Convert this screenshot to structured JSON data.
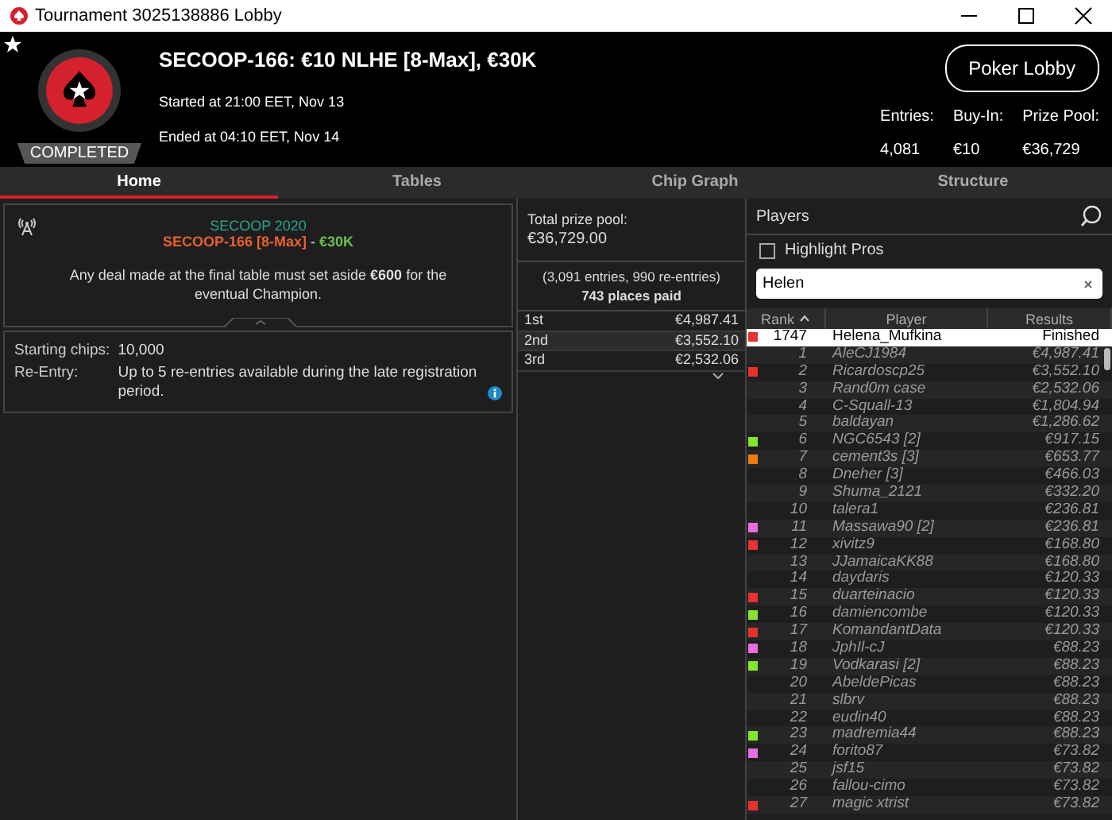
{
  "window": {
    "title": "Tournament 3025138886 Lobby"
  },
  "header": {
    "favorite": true,
    "status": "COMPLETED",
    "title": "SECOOP-166: €10 NLHE [8-Max], €30K",
    "started": "Started at 21:00 EET, Nov 13",
    "ended": "Ended at 04:10 EET, Nov 14",
    "lobby_button": "Poker Lobby",
    "stats": [
      {
        "label": "Entries:",
        "value": "4,081"
      },
      {
        "label": "Buy-In:",
        "value": "€10"
      },
      {
        "label": "Prize Pool:",
        "value": "€36,729"
      }
    ]
  },
  "tabs": [
    {
      "label": "Home",
      "selected": true
    },
    {
      "label": "Tables",
      "selected": false
    },
    {
      "label": "Chip Graph",
      "selected": false
    },
    {
      "label": "Structure",
      "selected": false
    }
  ],
  "info": {
    "series": "SECOOP 2020",
    "event": "SECOOP-166 [8-Max]",
    "separator": " - ",
    "guarantee": "€30K",
    "note": "Any deal made at the final table must set aside **€600** for the eventual Champion."
  },
  "details": [
    {
      "label": "Starting chips:",
      "value": "10,000",
      "info": false
    },
    {
      "label": "Re-Entry:",
      "value": "Up to 5 re-entries available during the late registration period.",
      "info": true
    }
  ],
  "prizes": {
    "total_label": "Total prize pool:",
    "total": "€36,729.00",
    "entries": "(3,091 entries, 990 re-entries)",
    "paid": "743 places paid",
    "rows": [
      {
        "place": "1st",
        "amount": "€4,987.41"
      },
      {
        "place": "2nd",
        "amount": "€3,552.10"
      },
      {
        "place": "3rd",
        "amount": "€2,532.06"
      }
    ]
  },
  "players": {
    "title": "Players",
    "highlight_pros": {
      "label": "Highlight Pros",
      "checked": false
    },
    "search": {
      "value": "Helen"
    },
    "columns": [
      "Rank",
      "Player",
      "Results"
    ],
    "found": {
      "rank": "1747",
      "player": "Helena_Mufkina",
      "result": "Finished",
      "color": "#e8322e"
    },
    "rows": [
      {
        "rank": "1",
        "player": "AleCJ1984",
        "result": "€4,987.41"
      },
      {
        "rank": "2",
        "player": "Ricardoscp25",
        "result": "€3,552.10",
        "color": "#e8322e"
      },
      {
        "rank": "3",
        "player": "Rand0m case",
        "result": "€2,532.06"
      },
      {
        "rank": "4",
        "player": "C-Squall-13",
        "result": "€1,804.94"
      },
      {
        "rank": "5",
        "player": "baldayan",
        "result": "€1,286.62"
      },
      {
        "rank": "6",
        "player": "NGC6543 [2]",
        "result": "€917.15",
        "color": "#86e52c"
      },
      {
        "rank": "7",
        "player": "cement3s [3]",
        "result": "€653.77",
        "color": "#f07c10"
      },
      {
        "rank": "8",
        "player": "Dneher [3]",
        "result": "€466.03"
      },
      {
        "rank": "9",
        "player": "Shuma_2121",
        "result": "€332.20"
      },
      {
        "rank": "10",
        "player": "talera1",
        "result": "€236.81"
      },
      {
        "rank": "11",
        "player": "Massawa90 [2]",
        "result": "€236.81",
        "color": "#e86de0"
      },
      {
        "rank": "12",
        "player": "xivitz9",
        "result": "€168.80",
        "color": "#e8322e"
      },
      {
        "rank": "13",
        "player": "JJamaicaKK88",
        "result": "€168.80"
      },
      {
        "rank": "14",
        "player": "daydaris",
        "result": "€120.33"
      },
      {
        "rank": "15",
        "player": "duarteinacio",
        "result": "€120.33",
        "color": "#e8322e"
      },
      {
        "rank": "16",
        "player": "damiencombe",
        "result": "€120.33",
        "color": "#86e52c"
      },
      {
        "rank": "17",
        "player": "KomandantData",
        "result": "€120.33",
        "color": "#e8322e"
      },
      {
        "rank": "18",
        "player": "JphIl-cJ",
        "result": "€88.23",
        "color": "#e86de0"
      },
      {
        "rank": "19",
        "player": "Vodkarasi [2]",
        "result": "€88.23",
        "color": "#86e52c"
      },
      {
        "rank": "20",
        "player": "AbeldePicas",
        "result": "€88.23"
      },
      {
        "rank": "21",
        "player": "slbrv",
        "result": "€88.23"
      },
      {
        "rank": "22",
        "player": "eudin40",
        "result": "€88.23"
      },
      {
        "rank": "23",
        "player": "madremia44",
        "result": "€88.23",
        "color": "#86e52c"
      },
      {
        "rank": "24",
        "player": "forito87",
        "result": "€73.82",
        "color": "#e86de0"
      },
      {
        "rank": "25",
        "player": "jsf15",
        "result": "€73.82"
      },
      {
        "rank": "26",
        "player": "fallou-cimo",
        "result": "€73.82"
      },
      {
        "rank": "27",
        "player": "magic xtrist",
        "result": "€73.82",
        "color": "#e8322e"
      }
    ]
  }
}
